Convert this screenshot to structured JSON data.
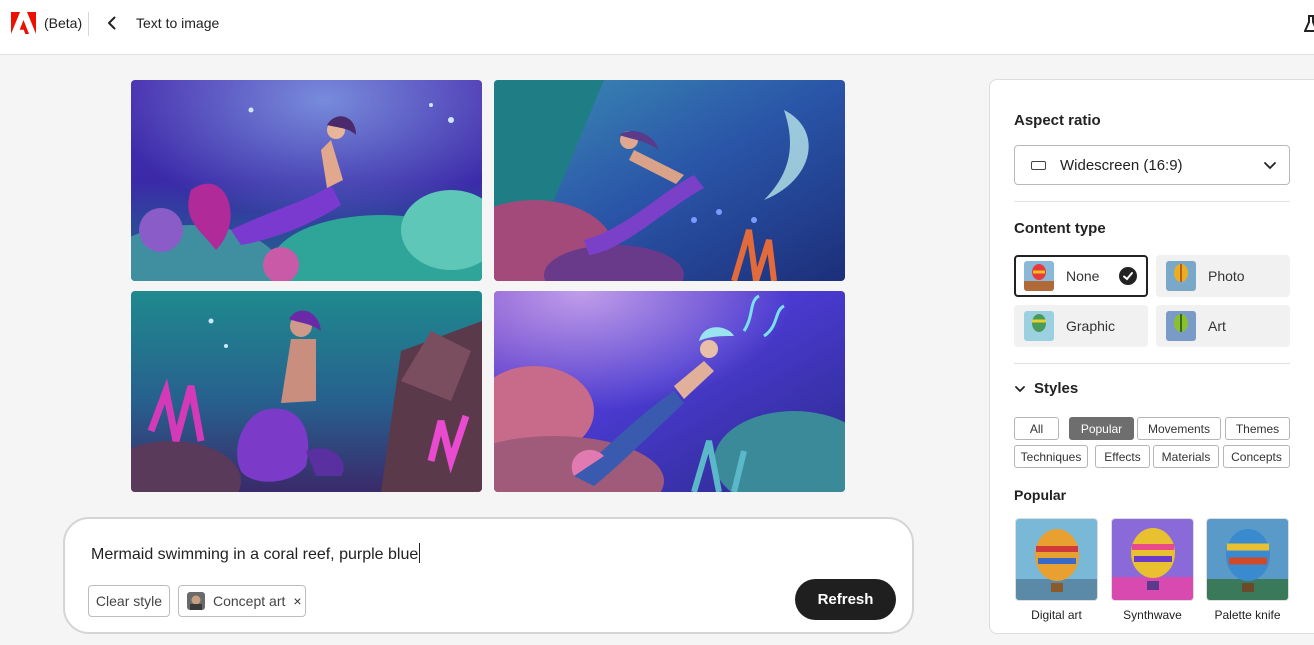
{
  "header": {
    "beta_label": "(Beta)",
    "page_title": "Text to image"
  },
  "images": [
    {
      "name": "generated-image-1"
    },
    {
      "name": "generated-image-2"
    },
    {
      "name": "generated-image-3"
    },
    {
      "name": "generated-image-4"
    }
  ],
  "prompt": {
    "text": "Mermaid swimming in a coral reef, purple blue",
    "clear_style_label": "Clear style",
    "applied_style_label": "Concept art",
    "remove_symbol": "×",
    "refresh_label": "Refresh"
  },
  "panel": {
    "aspect_ratio_title": "Aspect ratio",
    "aspect_ratio_value": "Widescreen (16:9)",
    "content_type_title": "Content type",
    "content_types": [
      {
        "label": "None",
        "selected": true
      },
      {
        "label": "Photo",
        "selected": false
      },
      {
        "label": "Graphic",
        "selected": false
      },
      {
        "label": "Art",
        "selected": false
      }
    ],
    "styles_title": "Styles",
    "style_tags": [
      {
        "label": "All",
        "active": false
      },
      {
        "label": "Popular",
        "active": true
      },
      {
        "label": "Movements",
        "active": false
      },
      {
        "label": "Themes",
        "active": false
      },
      {
        "label": "Techniques",
        "active": false
      },
      {
        "label": "Effects",
        "active": false
      },
      {
        "label": "Materials",
        "active": false
      },
      {
        "label": "Concepts",
        "active": false
      }
    ],
    "popular_title": "Popular",
    "popular_styles": [
      {
        "label": "Digital art"
      },
      {
        "label": "Synthwave"
      },
      {
        "label": "Palette knife"
      }
    ]
  },
  "colors": {
    "adobe_red": "#eb1000",
    "refresh_bg": "#1f1f1f",
    "active_tag": "#6e6e6e"
  }
}
